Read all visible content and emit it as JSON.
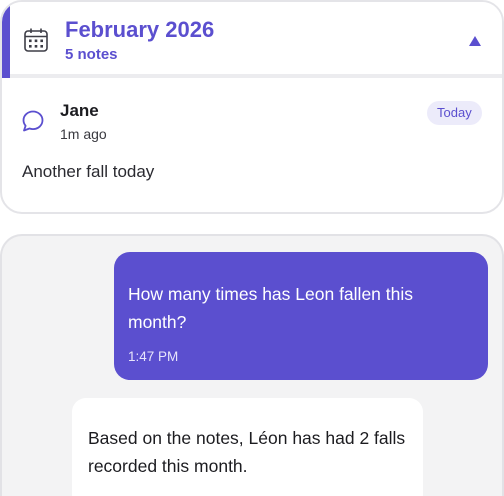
{
  "colors": {
    "accent": "#5b4fcf",
    "badge_bg": "#ecebfa",
    "panel_bg": "#f3f3f4"
  },
  "notes_group": {
    "icon": "calendar-icon",
    "title": "February 2026",
    "count": "5 notes",
    "toggle_icon": "chevron-up-icon"
  },
  "note": {
    "icon": "chat-bubble-icon",
    "author": "Jane",
    "time": "1m ago",
    "badge": "Today",
    "text": "Another fall today"
  },
  "chat": {
    "user_message": {
      "text": "How many times has Leon fallen this month?",
      "time": "1:47 PM"
    },
    "assistant_message": {
      "text": "Based on the notes, Léon has had 2 falls recorded this month."
    }
  }
}
